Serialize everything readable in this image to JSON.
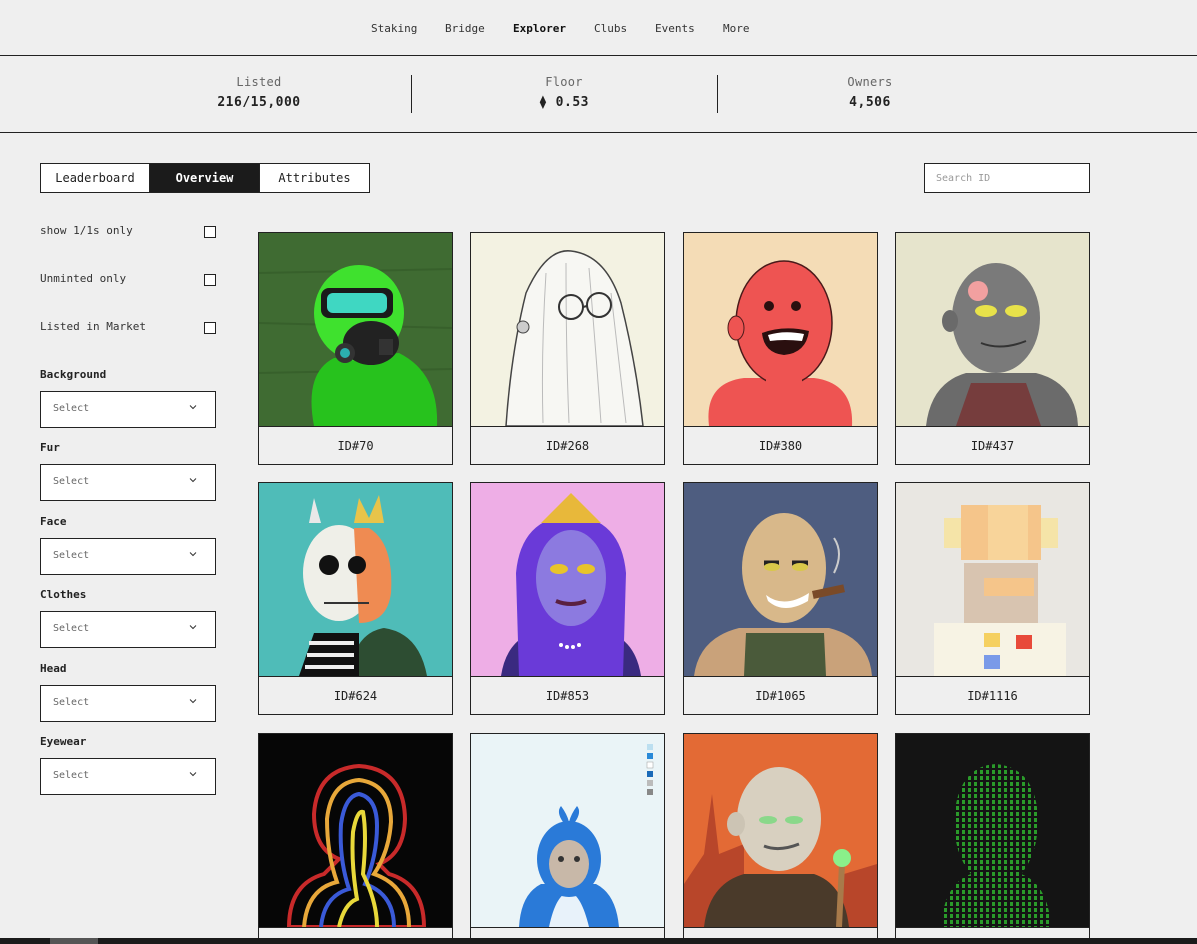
{
  "nav": {
    "items": [
      {
        "label": "Staking"
      },
      {
        "label": "Bridge"
      },
      {
        "label": "Explorer"
      },
      {
        "label": "Clubs"
      },
      {
        "label": "Events"
      },
      {
        "label": "More"
      }
    ],
    "active": "Explorer"
  },
  "stats": [
    {
      "label": "Listed",
      "value": "216/15,000"
    },
    {
      "label": "Floor",
      "value": "⧫ 0.53"
    },
    {
      "label": "Owners",
      "value": "4,506"
    }
  ],
  "tabs": [
    {
      "label": "Leaderboard"
    },
    {
      "label": "Overview"
    },
    {
      "label": "Attributes"
    }
  ],
  "active_tab": "Overview",
  "search": {
    "placeholder": "Search ID",
    "value": ""
  },
  "checkboxes": [
    {
      "label": "show 1/1s only",
      "checked": false
    },
    {
      "label": "Unminted only",
      "checked": false
    },
    {
      "label": "Listed in Market",
      "checked": false
    }
  ],
  "filters": [
    {
      "label": "Background",
      "value": "Select"
    },
    {
      "label": "Fur",
      "value": "Select"
    },
    {
      "label": "Face",
      "value": "Select"
    },
    {
      "label": "Clothes",
      "value": "Select"
    },
    {
      "label": "Head",
      "value": "Select"
    },
    {
      "label": "Eyewear",
      "value": "Select"
    }
  ],
  "cards": [
    {
      "id": "ID#70",
      "bg": "#3f6b32"
    },
    {
      "id": "ID#268",
      "bg": "#f3f2e2"
    },
    {
      "id": "ID#380",
      "bg": "#f4dcb6"
    },
    {
      "id": "ID#437",
      "bg": "#e6e4cc"
    },
    {
      "id": "ID#624",
      "bg": "#4fbcb8"
    },
    {
      "id": "ID#853",
      "bg": "#eeaee6"
    },
    {
      "id": "ID#1065",
      "bg": "#4e5d80"
    },
    {
      "id": "ID#1116",
      "bg": "#e9e7e2"
    },
    {
      "id": "",
      "bg": "#060606"
    },
    {
      "id": "",
      "bg": "#eaf4f7"
    },
    {
      "id": "",
      "bg": "#e36a35"
    },
    {
      "id": "",
      "bg": "#141414"
    }
  ],
  "colors": {
    "page_bg": "#efefef",
    "border": "#222222",
    "active_tab_bg": "#1b1b1b"
  },
  "icons": {
    "select_chevron": "chevron-down-icon",
    "floor_currency": "eth-icon"
  }
}
